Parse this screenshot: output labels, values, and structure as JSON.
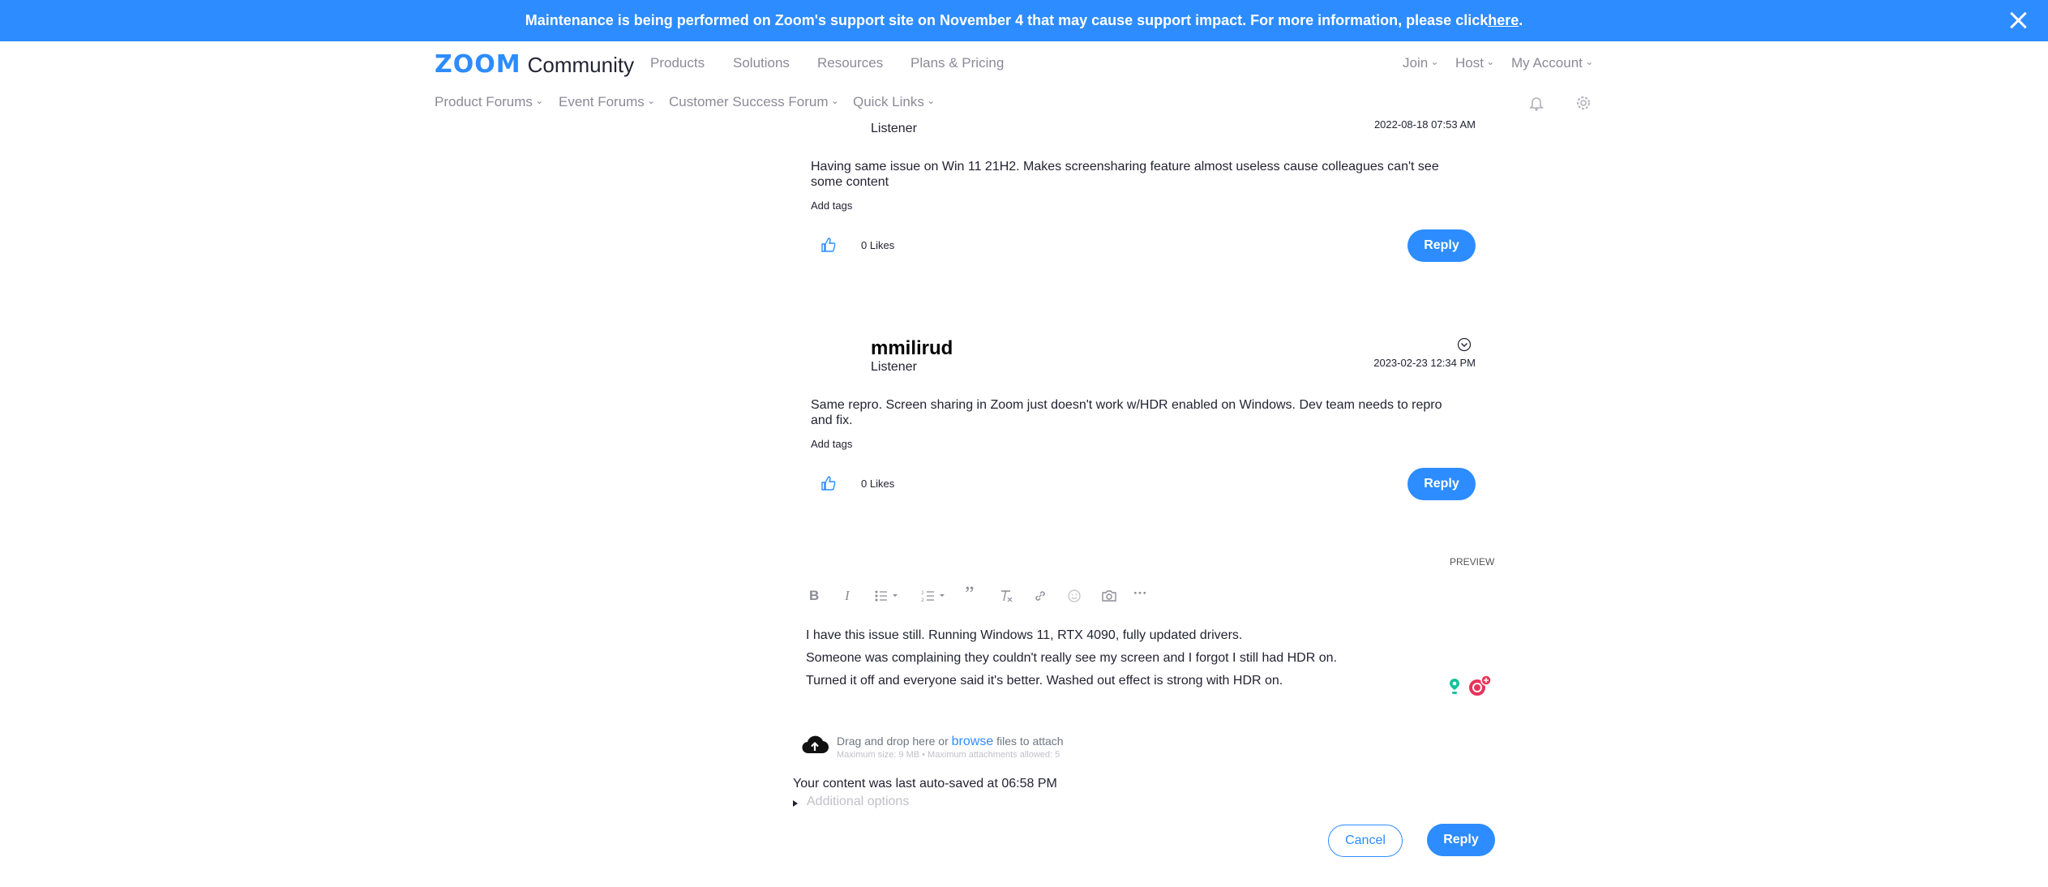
{
  "banner": {
    "text": "Maintenance is being performed on Zoom's support site on November 4 that may cause support impact. For more information, please click ",
    "link": "here",
    "suffix": "."
  },
  "header": {
    "logo_zoom": "ZOOM",
    "logo_community": "Community",
    "nav": [
      "Products",
      "Solutions",
      "Resources",
      "Plans & Pricing"
    ],
    "account": [
      "Join",
      "Host",
      "My Account"
    ],
    "subnav": [
      "Product Forums",
      "Event Forums",
      "Customer Success Forum",
      "Quick Links"
    ]
  },
  "posts": [
    {
      "role": "Listener",
      "timestamp": "2022-08-18 07:53 AM",
      "body_line1": "Having same issue on Win 11 21H2. Makes screensharing feature almost useless cause colleagues can't see",
      "body_line2": "some content",
      "add_tags": "Add tags",
      "likes": "0 Likes",
      "reply": "Reply"
    },
    {
      "author": "mmilirud",
      "role": "Listener",
      "timestamp": "2023-02-23 12:34 PM",
      "body_line1": "Same repro. Screen sharing in Zoom just doesn't work w/HDR enabled on Windows. Dev team needs to repro",
      "body_line2": "and fix.",
      "add_tags": "Add tags",
      "likes": "0 Likes",
      "reply": "Reply"
    }
  ],
  "editor": {
    "preview": "PREVIEW",
    "toolbar": {
      "bold": "B",
      "italic": "I",
      "quote": "”",
      "more": "···"
    },
    "lines": [
      "I have this issue still. Running Windows 11, RTX 4090, fully updated drivers.",
      "Someone was complaining they couldn't really see my screen and I forgot I still had HDR on.",
      "Turned it off and everyone said it's better. Washed out effect is strong with HDR on."
    ],
    "attach_prefix": "Drag and drop here or ",
    "attach_link": "browse",
    "attach_suffix": " files to attach",
    "attach_limits": "Maximum size: 9 MB • Maximum attachments allowed: 5",
    "autosave": "Your content was last auto-saved at 06:58 PM",
    "additional_options": "Additional options",
    "cancel": "Cancel",
    "reply": "Reply"
  },
  "colors": {
    "accent": "#2d8cff",
    "text": "#232333",
    "muted": "#8b8b97"
  }
}
